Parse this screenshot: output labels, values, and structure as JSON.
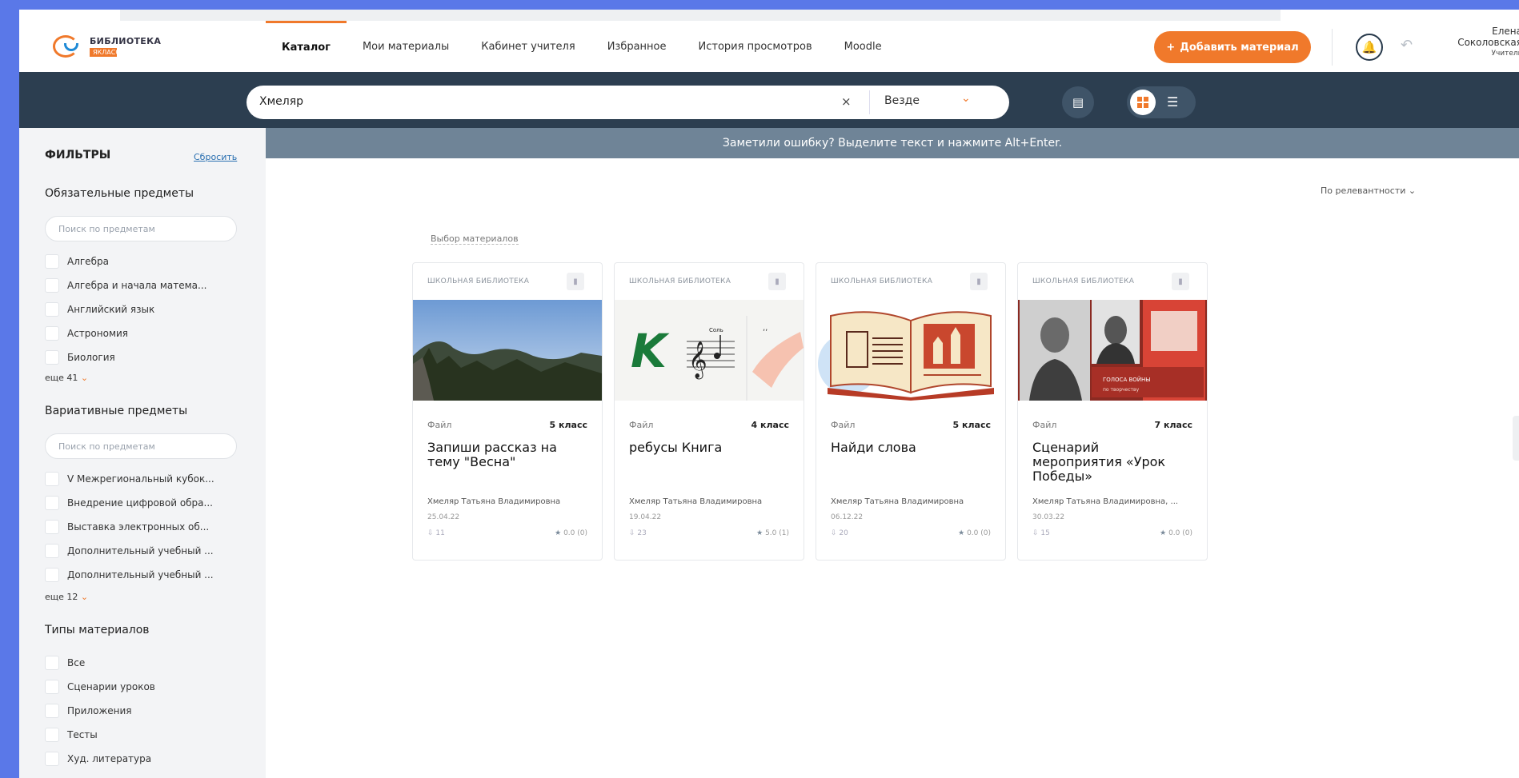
{
  "app": {
    "logo_line1": "БИБЛИОТЕКА",
    "logo_line2": "ЯКЛАСС"
  },
  "nav": {
    "tabs": [
      {
        "label": "Каталог",
        "active": true
      },
      {
        "label": "Мои материалы"
      },
      {
        "label": "Кабинет учителя"
      },
      {
        "label": "Избранное"
      },
      {
        "label": "История просмотров"
      },
      {
        "label": "Moodle"
      }
    ]
  },
  "header": {
    "add_button": "Добавить материал",
    "user_first": "Елена",
    "user_last": "Соколовская",
    "user_role": "Учитель"
  },
  "search": {
    "query": "Хмеляр",
    "scope": "Везде"
  },
  "notice": "Заметили ошибку? Выделите текст и нажмите Alt+Enter.",
  "sidebar": {
    "title": "ФИЛЬТРЫ",
    "reset": "Сбросить",
    "required_title": "Обязательные предметы",
    "required_placeholder": "Поиск по предметам",
    "required_items": [
      "Алгебра",
      "Алгебра и начала матема...",
      "Английский язык",
      "Астрономия",
      "Биология"
    ],
    "required_more": "еще 41",
    "variative_title": "Вариативные предметы",
    "variative_placeholder": "Поиск по предметам",
    "variative_items": [
      "V Межрегиональный кубок...",
      "Внедрение цифровой обра...",
      "Выставка электронных об...",
      "Дополнительный учебный ...",
      "Дополнительный учебный ..."
    ],
    "variative_more": "еще 12",
    "types_title": "Типы материалов",
    "types_items": [
      "Все",
      "Сценарии уроков",
      "Приложения",
      "Тесты",
      "Худ. литература"
    ]
  },
  "content": {
    "sort": "По релевантности",
    "selection_label": "Выбор материалов",
    "cards": [
      {
        "source": "ШКОЛЬНАЯ БИБЛИОТЕКА",
        "type": "Файл",
        "grade": "5 класс",
        "title": "Запиши рассказ на тему \"Весна\"",
        "author": "Хмеляр Татьяна Владимировна",
        "date": "25.04.22",
        "downloads": "11",
        "rating": "0.0 (0)"
      },
      {
        "source": "ШКОЛЬНАЯ БИБЛИОТЕКА",
        "type": "Файл",
        "grade": "4 класс",
        "title": "ребусы Книга",
        "author": "Хмеляр Татьяна Владимировна",
        "date": "19.04.22",
        "downloads": "23",
        "rating": "5.0 (1)"
      },
      {
        "source": "ШКОЛЬНАЯ БИБЛИОТЕКА",
        "type": "Файл",
        "grade": "5 класс",
        "title": "Найди слова",
        "author": "Хмеляр Татьяна Владимировна",
        "date": "06.12.22",
        "downloads": "20",
        "rating": "0.0 (0)"
      },
      {
        "source": "ШКОЛЬНАЯ БИБЛИОТЕКА",
        "type": "Файл",
        "grade": "7 класс",
        "title": "Сценарий мероприятия «Урок Победы»",
        "author": "Хмеляр Татьяна Владимировна, ...",
        "date": "30.03.22",
        "downloads": "15",
        "rating": "0.0 (0)"
      }
    ]
  },
  "colors": {
    "accent": "#f0792b",
    "dark_bar": "#2c3e50",
    "notice_bar": "#6f8497",
    "frame": "#5a78e8"
  },
  "icons": [
    "logo-icon",
    "plus-icon",
    "bell-icon",
    "undo-icon",
    "clear-icon",
    "chevron-down-icon",
    "calendar-icon",
    "grid-view-icon",
    "list-view-icon",
    "bookmark-icon",
    "download-icon",
    "star-icon"
  ]
}
